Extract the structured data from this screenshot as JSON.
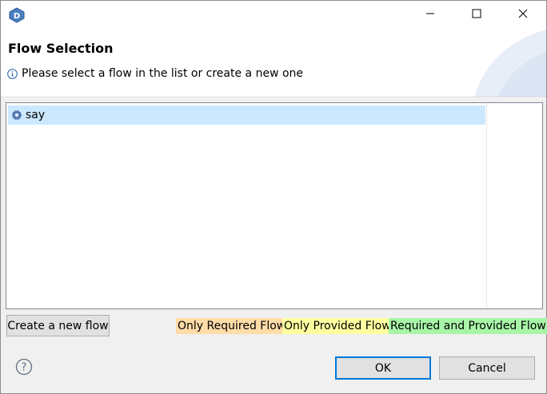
{
  "window": {
    "app_icon": "app-d-icon",
    "controls": [
      "minimize-icon",
      "maximize-icon",
      "close-icon"
    ]
  },
  "header": {
    "title": "Flow Selection",
    "message": "Please select a flow in the list or create a new one",
    "message_icon": "info-icon"
  },
  "list": {
    "items": [
      {
        "label": "say",
        "icon": "flow-gear-icon",
        "selected": true
      }
    ]
  },
  "actions": {
    "create_label": "Create a new flow"
  },
  "legend": {
    "required_only": {
      "label": "Only Required Flow",
      "color": "#ffdca8"
    },
    "provided_only": {
      "label": "Only Provided Flow",
      "color": "#ffffa0"
    },
    "both": {
      "label": "Required and Provided Flow",
      "color": "#a8f5a8"
    }
  },
  "footer": {
    "help_icon": "help-icon",
    "ok_label": "OK",
    "cancel_label": "Cancel"
  },
  "colors": {
    "selection": "#cce8ff",
    "default_button_border": "#0078d7"
  }
}
